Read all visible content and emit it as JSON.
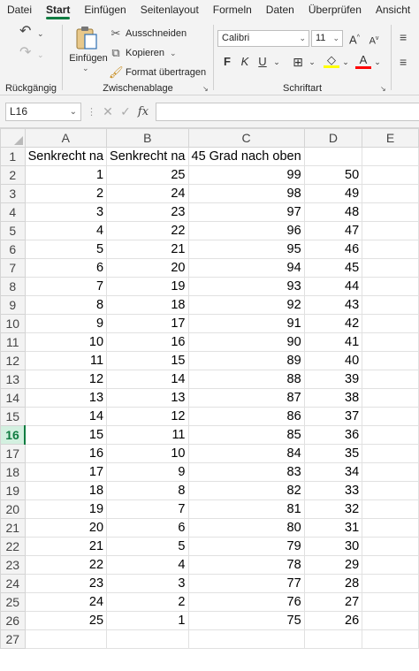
{
  "menu": {
    "tabs": [
      "Datei",
      "Start",
      "Einfügen",
      "Seitenlayout",
      "Formeln",
      "Daten",
      "Überprüfen",
      "Ansicht"
    ],
    "active": "Start"
  },
  "ribbon": {
    "undo_group_label": "Rückgängig",
    "clipboard": {
      "paste_label": "Einfügen",
      "cut_label": "Ausschneiden",
      "copy_label": "Kopieren",
      "format_painter_label": "Format übertragen",
      "group_label": "Zwischenablage"
    },
    "font": {
      "font_name": "Calibri",
      "font_size": "11",
      "bold": "F",
      "italic": "K",
      "underline": "U",
      "grow": "A",
      "shrink": "A",
      "font_color_glyph": "A",
      "group_label": "Schriftart",
      "fill_color": "#ffff00",
      "font_color": "#ff0000"
    }
  },
  "formula_bar": {
    "name_box": "L16",
    "fx": "fx",
    "formula": ""
  },
  "sheet": {
    "columns": [
      "A",
      "B",
      "C",
      "D",
      "E"
    ],
    "selected_row": 16,
    "header_row": [
      "Senkrecht na",
      "Senkrecht na",
      "45 Grad nach oben",
      "",
      ""
    ],
    "rows": [
      [
        1,
        25,
        99,
        50
      ],
      [
        2,
        24,
        98,
        49
      ],
      [
        3,
        23,
        97,
        48
      ],
      [
        4,
        22,
        96,
        47
      ],
      [
        5,
        21,
        95,
        46
      ],
      [
        6,
        20,
        94,
        45
      ],
      [
        7,
        19,
        93,
        44
      ],
      [
        8,
        18,
        92,
        43
      ],
      [
        9,
        17,
        91,
        42
      ],
      [
        10,
        16,
        90,
        41
      ],
      [
        11,
        15,
        89,
        40
      ],
      [
        12,
        14,
        88,
        39
      ],
      [
        13,
        13,
        87,
        38
      ],
      [
        14,
        12,
        86,
        37
      ],
      [
        15,
        11,
        85,
        36
      ],
      [
        16,
        10,
        84,
        35
      ],
      [
        17,
        9,
        83,
        34
      ],
      [
        18,
        8,
        82,
        33
      ],
      [
        19,
        7,
        81,
        32
      ],
      [
        20,
        6,
        80,
        31
      ],
      [
        21,
        5,
        79,
        30
      ],
      [
        22,
        4,
        78,
        29
      ],
      [
        23,
        3,
        77,
        28
      ],
      [
        24,
        2,
        76,
        27
      ],
      [
        25,
        1,
        75,
        26
      ]
    ],
    "extra_row_numbers": [
      27
    ]
  }
}
